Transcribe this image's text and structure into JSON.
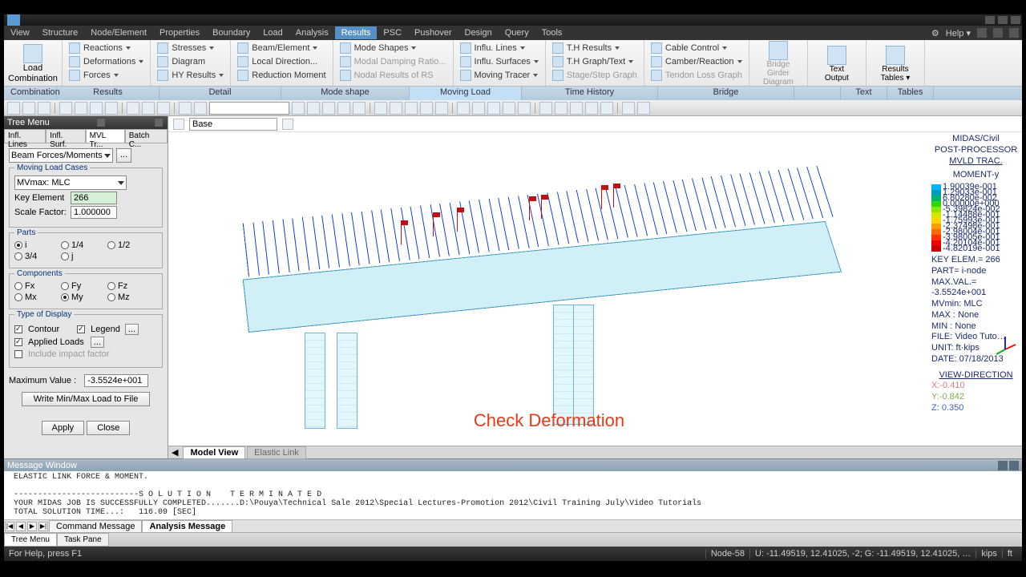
{
  "menubar": [
    "View",
    "Structure",
    "Node/Element",
    "Properties",
    "Boundary",
    "Load",
    "Analysis",
    "Results",
    "PSC",
    "Pushover",
    "Design",
    "Query",
    "Tools"
  ],
  "menubar_active": 7,
  "help_label": "Help",
  "ribbon": {
    "big": {
      "label": "Load\nCombination"
    },
    "groups": [
      {
        "items": [
          {
            "l": "Reactions",
            "d": true
          },
          {
            "l": "Deformations",
            "d": true
          },
          {
            "l": "Forces",
            "d": true
          }
        ],
        "tab": "Combination"
      },
      {
        "items": [
          {
            "l": "Stresses",
            "d": true
          },
          {
            "l": "Diagram"
          },
          {
            "l": "HY Results",
            "d": true
          }
        ],
        "tab": "Results"
      },
      {
        "items": [
          {
            "l": "Beam/Element",
            "d": true
          },
          {
            "l": "Local Direction..."
          },
          {
            "l": "Reduction Moment"
          }
        ],
        "tab": "Detail"
      },
      {
        "items": [
          {
            "l": "Mode Shapes",
            "d": true
          },
          {
            "l": "Modal Damping Ratio...",
            "dis": true
          },
          {
            "l": "Nodal Results of RS",
            "dis": true
          }
        ],
        "tab": "Mode shape"
      },
      {
        "items": [
          {
            "l": "Influ. Lines",
            "d": true
          },
          {
            "l": "Influ. Surfaces",
            "d": true
          },
          {
            "l": "Moving Tracer",
            "d": true
          }
        ],
        "tab": "Moving Load",
        "sel": true
      },
      {
        "items": [
          {
            "l": "T.H Results",
            "d": true
          },
          {
            "l": "T.H Graph/Text",
            "d": true
          },
          {
            "l": "Stage/Step Graph",
            "dis": true
          }
        ],
        "tab": "Time History"
      },
      {
        "items": [
          {
            "l": "Cable Control",
            "d": true
          },
          {
            "l": "Camber/Reaction",
            "d": true
          },
          {
            "l": "Tendon Loss Graph",
            "dis": true
          }
        ],
        "tab": "Bridge"
      }
    ],
    "big2": [
      {
        "l": "Bridge Girder\nDiagram",
        "dis": true
      },
      {
        "l": "Text\nOutput"
      },
      {
        "l": "Results\nTables",
        "d": true
      }
    ],
    "tabs2": [
      "",
      "Text",
      "Tables"
    ]
  },
  "tree": {
    "title": "Tree Menu",
    "tabs": [
      "Infl. Lines",
      "Infl. Surf.",
      "MVL Tr...",
      "Batch C..."
    ],
    "active_tab": 2,
    "combo": "Beam Forces/Moments",
    "mlc": {
      "legend": "Moving Load Cases",
      "value": "MVmax: MLC"
    },
    "key_element": {
      "label": "Key Element",
      "value": "266"
    },
    "scale": {
      "label": "Scale Factor:",
      "value": "1.000000"
    },
    "parts": {
      "legend": "Parts",
      "opts": [
        "i",
        "1/4",
        "1/2",
        "3/4",
        "j"
      ],
      "sel": 0
    },
    "components": {
      "legend": "Components",
      "opts": [
        "Fx",
        "Fy",
        "Fz",
        "Mx",
        "My",
        "Mz"
      ],
      "sel": 4
    },
    "display": {
      "legend": "Type of Display",
      "contour": "Contour",
      "legend_l": "Legend",
      "applied": "Applied Loads",
      "impact": "Include impact factor"
    },
    "maxval": {
      "label": "Maximum Value :",
      "value": "-3.5524e+001"
    },
    "write": "Write Min/Max Load to File",
    "apply": "Apply",
    "close": "Close"
  },
  "viewport": {
    "view_combo": "Base",
    "overlay": "Check Deformation",
    "tabs": [
      "Model View",
      "Elastic Link"
    ],
    "active": 0
  },
  "legend": {
    "title1": "MIDAS/Civil",
    "title2": "POST-PROCESSOR",
    "title3": "MVLD TRAC.",
    "title4": "MOMENT-y",
    "colorbar": [
      {
        "c": "#00b6ff",
        "v": "1.90039e-001"
      },
      {
        "c": "#009bbd",
        "v": "1.29033e-001"
      },
      {
        "c": "#00b669",
        "v": "6.80280e-002"
      },
      {
        "c": "#2fd900",
        "v": "0.00000e+000"
      },
      {
        "c": "#8de600",
        "v": "-5.39824e-002"
      },
      {
        "c": "#d4e600",
        "v": "-1.14488e-001"
      },
      {
        "c": "#ffd400",
        "v": "-1.75993e-001"
      },
      {
        "c": "#ff9d00",
        "v": "-2.37498e-001"
      },
      {
        "c": "#ff6a00",
        "v": "-2.98004e-001"
      },
      {
        "c": "#ff3000",
        "v": "-3.98005e-001"
      },
      {
        "c": "#ef0000",
        "v": "-4.20104e-001"
      },
      {
        "c": "#c80000",
        "v": "-4.82019e-001"
      }
    ],
    "info": [
      "KEY ELEM.= 266",
      "PART= i-node",
      "MAX.VAL.=",
      "-3.5524e+001",
      "MVmin: MLC",
      "",
      "MAX : None",
      "MIN : None",
      "FILE: Video Tuto…",
      "UNIT: ft·kips",
      "DATE: 07/18/2013"
    ],
    "view_dir": {
      "title": "VIEW-DIRECTION",
      "x": "X:-0.410",
      "y": "Y:-0.842",
      "z": "Z: 0.350"
    }
  },
  "message": {
    "title": "Message Window",
    "lines": [
      " ELASTIC LINK FORCE & MOMENT.",
      "",
      " --------------------------S O L U T I O N    T E R M I N A T E D",
      " YOUR MIDAS JOB IS SUCCESSFULLY COMPLETED.......D:\\Pouya\\Technical Sale 2012\\Special Lectures-Promotion 2012\\Civil Training July\\Video Tutorials",
      " TOTAL SOLUTION TIME...:   116.09 [SEC]"
    ],
    "tabs": [
      "Command Message",
      "Analysis Message"
    ],
    "active": 1
  },
  "bottom_tabs": [
    "Tree Menu",
    "Task Pane"
  ],
  "status": {
    "hint": "For Help, press F1",
    "node": "Node-58",
    "coords": "U: -11.49519, 12.41025, -2; G: -11.49519, 12.41025, …",
    "unit1": "kips",
    "unit2": "ft"
  }
}
